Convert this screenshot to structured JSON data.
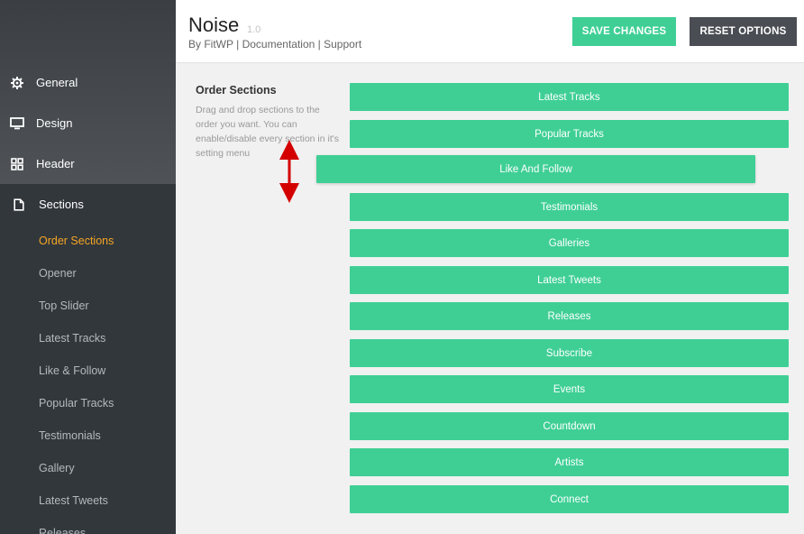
{
  "sidebar": {
    "nav": [
      {
        "label": "General",
        "icon": "gear-icon"
      },
      {
        "label": "Design",
        "icon": "monitor-icon"
      },
      {
        "label": "Header",
        "icon": "grid-icon"
      },
      {
        "label": "Sections",
        "icon": "document-icon"
      }
    ],
    "subitems": [
      {
        "label": "Order Sections",
        "active": true
      },
      {
        "label": "Opener"
      },
      {
        "label": "Top Slider"
      },
      {
        "label": "Latest Tracks"
      },
      {
        "label": "Like & Follow"
      },
      {
        "label": "Popular Tracks"
      },
      {
        "label": "Testimonials"
      },
      {
        "label": "Gallery"
      },
      {
        "label": "Latest Tweets"
      },
      {
        "label": "Releases"
      }
    ]
  },
  "header": {
    "title": "Noise",
    "version": "1.0",
    "by": "By FitWP",
    "sep": "|",
    "documentation": "Documentation",
    "support": "Support",
    "save_label": "SAVE CHANGES",
    "reset_label": "RESET OPTIONS"
  },
  "main": {
    "option_title": "Order Sections",
    "option_desc": "Drag and drop sections to the order you want. You can enable/disable every section in it's setting menu",
    "sections": [
      "Latest Tracks",
      "Popular Tracks",
      "Like And Follow",
      "Testimonials",
      "Galleries",
      "Latest Tweets",
      "Releases",
      "Subscribe",
      "Events",
      "Countdown",
      "Artists",
      "Connect"
    ],
    "dragging_index": 2
  },
  "colors": {
    "accent_green": "#3fcf95",
    "active_orange": "#f5a623",
    "sidebar_dark": "#32373c",
    "reset_button": "#4a4d53",
    "drag_arrow": "#d40000"
  }
}
